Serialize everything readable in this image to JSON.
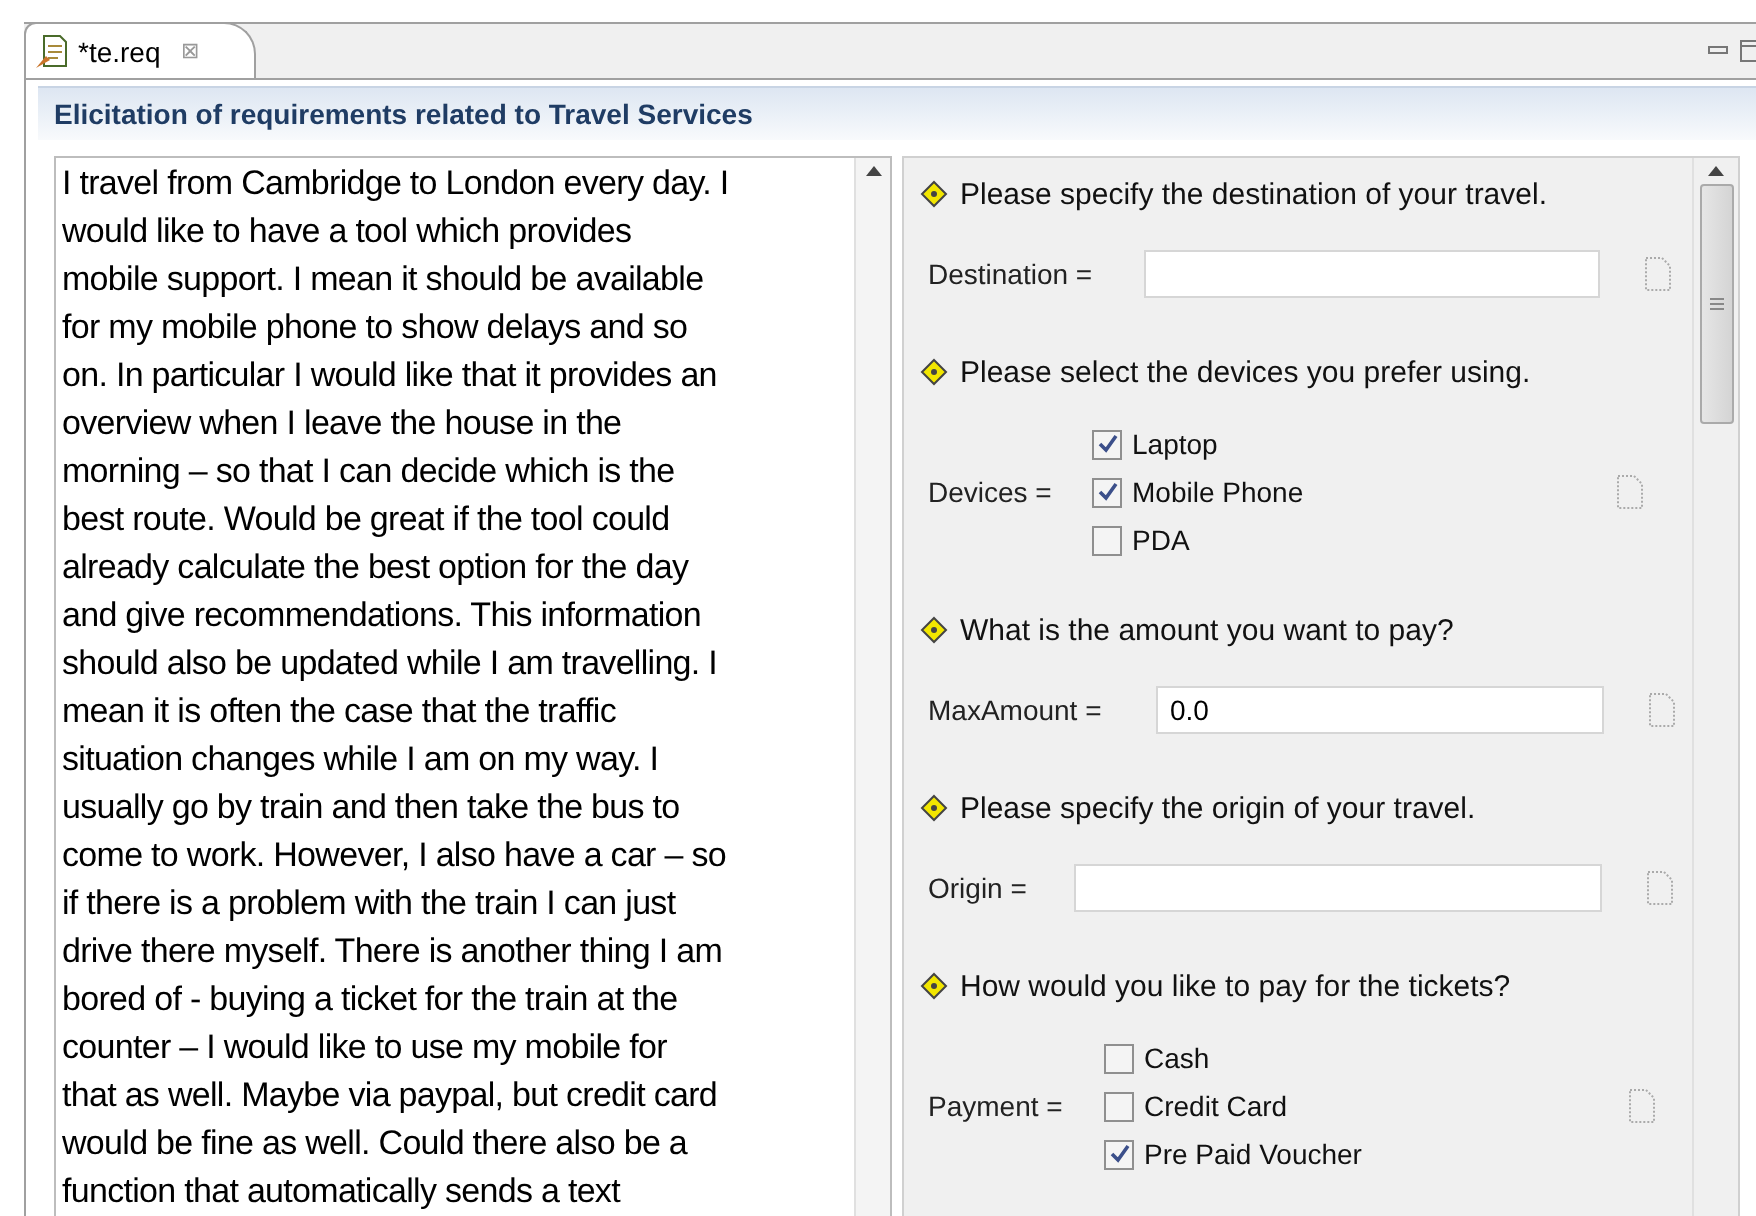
{
  "editor_tab": {
    "title": "*te.req",
    "close": "⊠"
  },
  "form_title": "Elicitation of requirements related to Travel Services",
  "description_lines": [
    "I travel from Cambridge to London every day. I",
    "would like to have a tool which provides",
    "mobile support. I mean it should be available",
    "for my mobile phone to show delays and so",
    "on. In particular I would like that it provides an",
    "overview when I leave the house in the",
    "morning – so that I can decide which is the",
    "best route. Would be great if the tool could",
    "already calculate the best option for the day",
    "and give recommendations. This information",
    "should also be updated while I am travelling. I",
    "mean it is often the case that the traffic",
    "situation changes while I am on my way. I",
    "usually go by train and then take the bus to",
    "come to work. However, I also have a car – so",
    "if there is a problem with the train I can just",
    "drive there myself. There is another thing I am",
    "bored of - buying a ticket for the train at the",
    "counter – I would like to use my mobile for",
    "that as well. Maybe via paypal, but credit card",
    "would be fine as well. Could there also be a",
    "function that automatically sends a text"
  ],
  "questions": [
    {
      "kind": "text",
      "question": "Please specify the destination of your travel.",
      "label": "Destination ="
    },
    {
      "kind": "checks",
      "question": "Please select the devices you prefer using.",
      "label": "Devices =",
      "options": [
        {
          "label": "Laptop",
          "checked": true
        },
        {
          "label": "Mobile Phone",
          "checked": true
        },
        {
          "label": "PDA",
          "checked": false
        }
      ]
    },
    {
      "kind": "text",
      "question": "What is the amount you want to pay?",
      "label": "MaxAmount =",
      "value": "0.0"
    },
    {
      "kind": "text",
      "question": "Please specify the origin of your travel.",
      "label": "Origin ="
    },
    {
      "kind": "checks",
      "question": "How would you like to pay for the tickets?",
      "label": "Payment =",
      "options": [
        {
          "label": "Cash",
          "checked": false
        },
        {
          "label": "Credit Card",
          "checked": false
        },
        {
          "label": "Pre Paid Voucher",
          "checked": true
        }
      ]
    }
  ]
}
